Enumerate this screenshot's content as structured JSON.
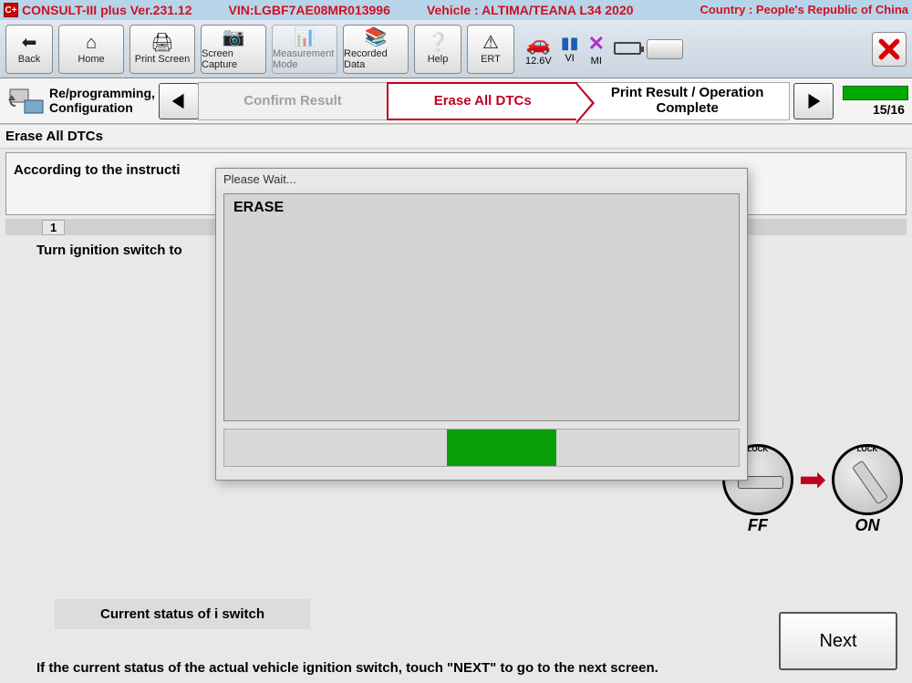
{
  "header": {
    "app_badge": "C+",
    "title": "CONSULT-III plus  Ver.231.12",
    "vin": "VIN:LGBF7AE08MR013996",
    "vehicle": "Vehicle : ALTIMA/TEANA L34 2020",
    "country": "Country : People's Republic of China"
  },
  "toolbar": {
    "back": "Back",
    "home": "Home",
    "print": "Print Screen",
    "capture": "Screen Capture",
    "measure": "Measurement Mode",
    "recorded": "Recorded Data",
    "help": "Help",
    "ert": "ERT",
    "voltage": "12.6V",
    "vi": "VI",
    "mi": "MI"
  },
  "flow": {
    "mode": "Re/programming, Configuration",
    "confirm": "Confirm Result",
    "erase": "Erase All DTCs",
    "print_result": "Print Result / Operation Complete",
    "progress": "15/16"
  },
  "section_title": "Erase All DTCs",
  "instruction": "According to the instructi",
  "step_num": "1",
  "step_text": "Turn ignition switch to",
  "dial_off": "FF",
  "dial_on": "ON",
  "dial_lock": "LOCK",
  "status_label": "Current status of i switch",
  "final_text": "If the current status of the actual vehicle ignition switch, touch \"NEXT\" to go to the next screen.",
  "next": "Next",
  "modal": {
    "title": "Please Wait...",
    "body": "ERASE"
  }
}
